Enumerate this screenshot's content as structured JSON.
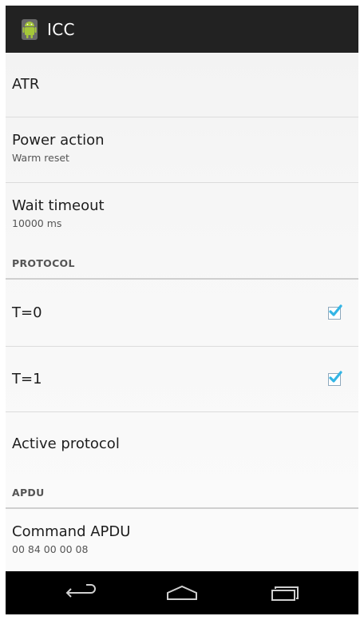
{
  "app": {
    "title": "ICC",
    "icon": "android-robot-icon"
  },
  "preferences": {
    "atr": {
      "title": "ATR"
    },
    "power_action": {
      "title": "Power action",
      "summary": "Warm reset"
    },
    "wait_timeout": {
      "title": "Wait timeout",
      "summary": "10000 ms"
    },
    "protocol_category": "PROTOCOL",
    "t0": {
      "title": "T=0",
      "checked": true
    },
    "t1": {
      "title": "T=1",
      "checked": true
    },
    "active_protocol": {
      "title": "Active protocol"
    },
    "apdu_category": "APDU",
    "command_apdu": {
      "title": "Command APDU",
      "summary": "00 84 00 00 08"
    }
  },
  "navbar": {
    "buttons": [
      "back-icon",
      "home-icon",
      "recent-apps-icon"
    ]
  },
  "colors": {
    "actionbar": "#222222",
    "checkmark": "#33b5e5",
    "navbar": "#000000"
  }
}
